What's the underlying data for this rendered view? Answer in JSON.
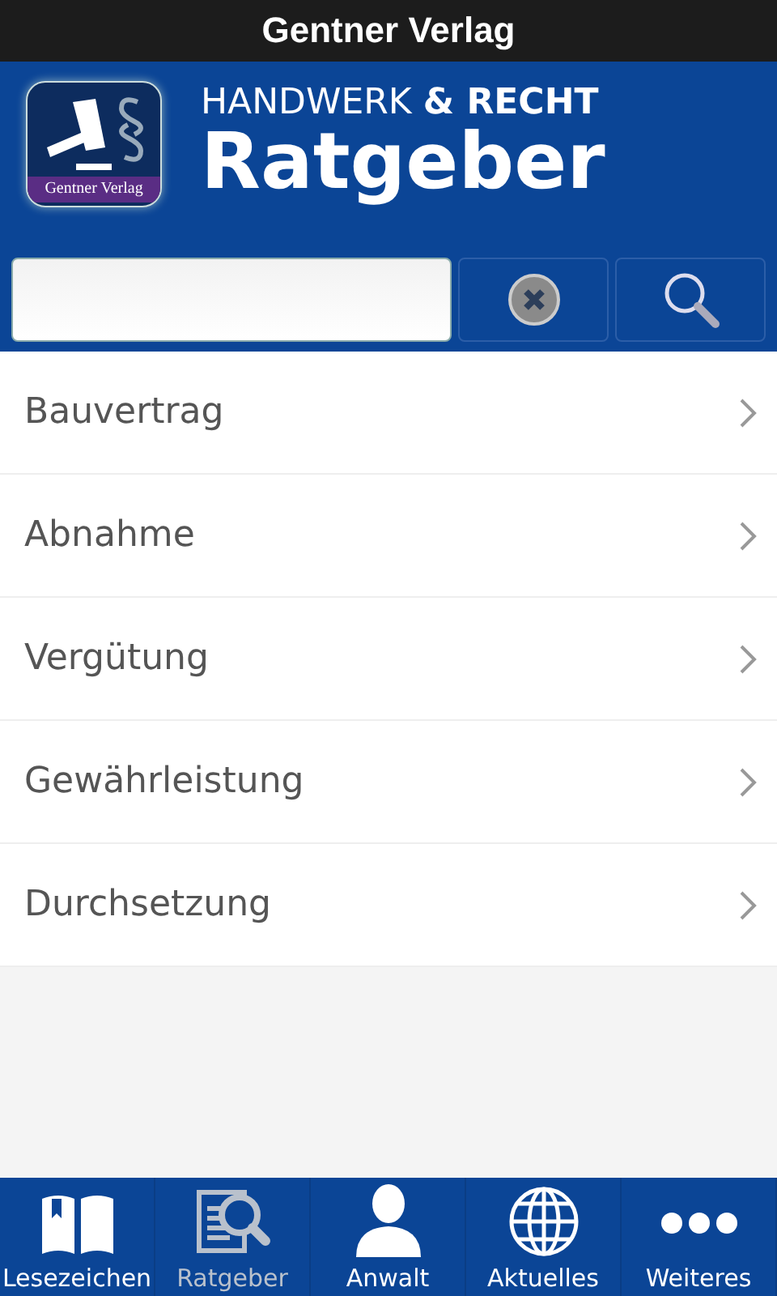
{
  "status_bar": {
    "title": "Gentner Verlag"
  },
  "header": {
    "logo_caption": "Gentner Verlag",
    "title_regular": "HANDWERK",
    "title_bold": "& RECHT",
    "subtitle": "Ratgeber"
  },
  "items": [
    {
      "label": "Bauvertrag"
    },
    {
      "label": "Abnahme"
    },
    {
      "label": "Vergütung"
    },
    {
      "label": "Gewährleistung"
    },
    {
      "label": "Durchsetzung"
    }
  ],
  "tabs": [
    {
      "label": "Lesezeichen",
      "kind": "book",
      "selected": false
    },
    {
      "label": "Ratgeber",
      "kind": "guide",
      "selected": true
    },
    {
      "label": "Anwalt",
      "kind": "person",
      "selected": false
    },
    {
      "label": "Aktuelles",
      "kind": "globe",
      "selected": false
    },
    {
      "label": "Weiteres",
      "kind": "more",
      "selected": false
    }
  ]
}
